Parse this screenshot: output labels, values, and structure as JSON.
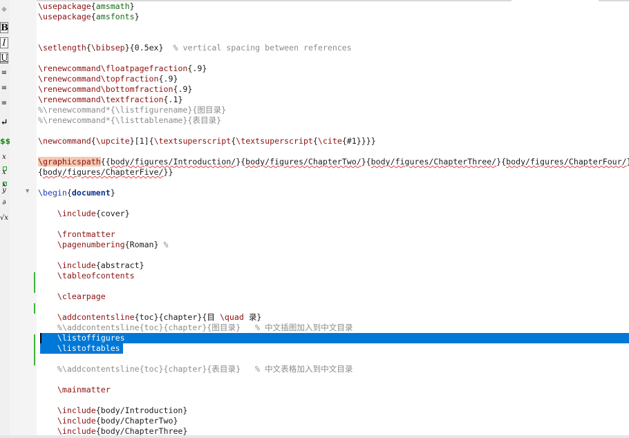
{
  "toolbar": {
    "bold": "B",
    "italic": "I",
    "underline": "U",
    "newline": "↵",
    "math_dollar": "$$",
    "subscript": "x",
    "superscript": "x",
    "fraction_num": "x",
    "fraction_den": "y",
    "partial": "∂",
    "sqrt": "√x"
  },
  "code": {
    "l01_cmd": "\\usepackage",
    "l01_arg": "amsmath",
    "l02_cmd": "\\usepackage",
    "l02_arg": "amsfonts",
    "l05_cmd": "\\setlength",
    "l05_arg1": "\\bibsep",
    "l05_arg2": "0.5ex",
    "l05_cmt": "% vertical spacing between references",
    "l07_cmd": "\\renewcommand\\floatpagefraction",
    "l07_arg": ".9",
    "l08_cmd": "\\renewcommand\\topfraction",
    "l08_arg": ".9",
    "l09_cmd": "\\renewcommand\\bottomfraction",
    "l09_arg": ".9",
    "l10_cmd": "\\renewcommand\\textfraction",
    "l10_arg": ".1",
    "l11_cmt": "%\\renewcommand*{\\listfigurename}{图目录}",
    "l12_cmt": "%\\renewcommand*{\\listtablename}{表目录}",
    "l14_cmd": "\\newcommand",
    "l14_arg1": "\\upcite",
    "l14_opt": "[1]",
    "l14_cmd2": "\\textsuperscript",
    "l14_cmd3": "\\textsuperscript",
    "l14_cmd4": "\\cite",
    "l14_arg2": "#1",
    "l16_cmd": "\\graphicspath",
    "l16_p1": "body/figures/Introduction/",
    "l16_p2": "body/figures/ChapterTwo/",
    "l16_p3": "body/figures/ChapterThree/",
    "l16_p4": "body/figures/ChapterFour/",
    "l17_p5": "body/figures/ChapterFive/",
    "l19_cmd": "\\begin",
    "l19_arg": "document",
    "l21_cmd": "\\include",
    "l21_arg": "cover",
    "l23_cmd": "\\frontmatter",
    "l24_cmd": "\\pagenumbering",
    "l24_arg": "Roman",
    "l24_cmt": "%",
    "l26_cmd": "\\include",
    "l26_arg": "abstract",
    "l27_cmd": "\\tableofcontents",
    "l29_cmd": "\\clearpage",
    "l31_cmd": "\\addcontentsline",
    "l31_arg1": "toc",
    "l31_arg2": "chapter",
    "l31_a": "目 ",
    "l31_quad": "\\quad",
    "l31_b": " 录",
    "l32_cmt": "%\\addcontentsline{toc}{chapter}{图目录}   % 中文插图加入到中文目录",
    "l33_cmd": "\\listoffigures",
    "l34_cmd": "\\listoftables",
    "l36_cmt": "%\\addcontentsline{toc}{chapter}{表目录}   % 中文表格加入到中文目录",
    "l38_cmd": "\\mainmatter",
    "l40_cmd": "\\include",
    "l40_arg": "body/Introduction",
    "l41_cmd": "\\include",
    "l41_arg": "body/ChapterTwo",
    "l42_cmd": "\\include",
    "l42_arg": "body/ChapterThree"
  }
}
